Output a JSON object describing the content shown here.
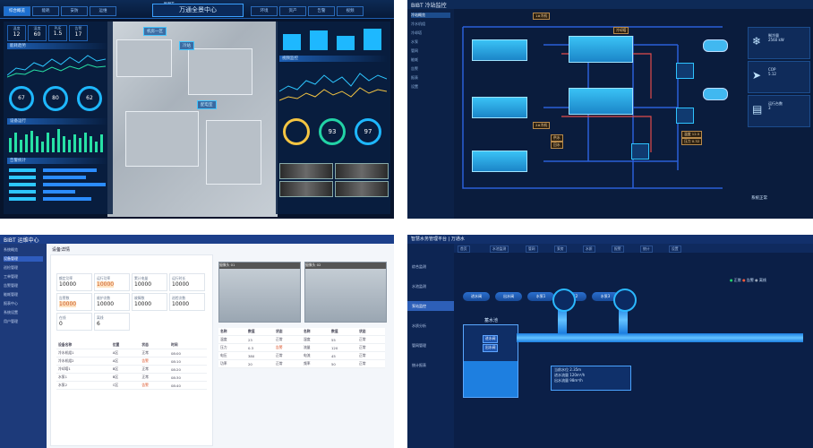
{
  "panel1": {
    "brand": "BIBT",
    "title": "万通全景中心",
    "tabs": [
      "综合概览",
      "能耗",
      "安防",
      "运维",
      "环境",
      "资产",
      "告警",
      "视频"
    ],
    "stats": [
      {
        "label": "温度",
        "value": "12"
      },
      {
        "label": "湿度",
        "value": "60"
      },
      {
        "label": "PUE",
        "value": "1.5"
      },
      {
        "label": "告警",
        "value": "17"
      }
    ],
    "rings": [
      "67",
      "80",
      "62"
    ],
    "big_rings": [
      "93",
      "97"
    ],
    "markers": [
      "机房一区",
      "冷站",
      "配电室"
    ],
    "sec_heads": [
      "能耗趋势",
      "设备运行",
      "告警统计",
      "视频监控"
    ]
  },
  "panel2": {
    "brand": "BIBT 冷站监控",
    "menu": [
      "冷站概览",
      "冷水机组",
      "冷却塔",
      "水泵",
      "管网",
      "能耗",
      "告警",
      "报表",
      "设置"
    ],
    "labels": [
      "1#冷机",
      "2#冷机",
      "冷却塔",
      "供水",
      "回水",
      "温度 12.5",
      "压力 0.32"
    ],
    "right_boxes": [
      {
        "icon": "❄",
        "lines": [
          "制冷量",
          "2560 kW"
        ]
      },
      {
        "icon": "➤",
        "lines": [
          "COP",
          "5.12"
        ]
      },
      {
        "icon": "▤",
        "lines": [
          "运行台数",
          "3"
        ]
      }
    ],
    "footer": "系统正常"
  },
  "panel3": {
    "brand": "BIBT 运维中心",
    "menu": [
      "系统概览",
      "设备管理",
      "巡检管理",
      "工单管理",
      "告警管理",
      "能耗管理",
      "报表中心",
      "系统设置",
      "用户管理"
    ],
    "page_title": "设备详情",
    "fields": [
      {
        "label": "额定功率",
        "value": "10000"
      },
      {
        "label": "运行功率",
        "value": "10000",
        "warn": true
      },
      {
        "label": "累计电量",
        "value": "10000"
      },
      {
        "label": "运行时长",
        "value": "10000"
      },
      {
        "label": "告警数",
        "value": "10000",
        "warn": true
      },
      {
        "label": "维护次数",
        "value": "10000"
      },
      {
        "label": "故障数",
        "value": "10000"
      },
      {
        "label": "巡检次数",
        "value": "10000"
      },
      {
        "label": "在线",
        "value": "0"
      },
      {
        "label": "离线",
        "value": "6"
      }
    ],
    "table_head": [
      "设备名称",
      "位置",
      "状态",
      "时间"
    ],
    "table_rows": [
      [
        "冷水机组1",
        "A区",
        "正常",
        "08:00"
      ],
      [
        "冷水机组2",
        "A区",
        "告警",
        "08:10"
      ],
      [
        "冷却塔1",
        "B区",
        "正常",
        "08:20"
      ],
      [
        "水泵1",
        "B区",
        "正常",
        "08:30"
      ],
      [
        "水泵2",
        "C区",
        "告警",
        "08:40"
      ]
    ],
    "cams": [
      "摄像头 01",
      "摄像头 02"
    ],
    "right_head": [
      "名称",
      "数值",
      "状态",
      "名称",
      "数值",
      "状态"
    ],
    "right_rows": [
      [
        "温度",
        "23",
        "正常",
        "湿度",
        "55",
        "正常"
      ],
      [
        "压力",
        "0.3",
        "告警",
        "流量",
        "120",
        "正常"
      ],
      [
        "电压",
        "380",
        "正常",
        "电流",
        "45",
        "正常"
      ],
      [
        "功率",
        "20",
        "正常",
        "频率",
        "50",
        "正常"
      ]
    ]
  },
  "panel4": {
    "brand": "智慧水务管理平台 | 万通水",
    "tabs": [
      "首页",
      "水池监测",
      "管网",
      "泵房",
      "水质",
      "报警",
      "统计",
      "设置"
    ],
    "menu": [
      "综合监测",
      "水池监测",
      "泵站监控",
      "水质分析",
      "管网管理",
      "统计报表"
    ],
    "buttons": [
      "进水阀",
      "出水阀",
      "水泵1",
      "水泵2",
      "水泵3"
    ],
    "tank_label": "蓄水池",
    "info_lines": [
      "当前水位 2.35m",
      "进水流量 120m³/h",
      "出水流量 98m³/h"
    ],
    "legend": [
      "正常",
      "告警",
      "离线"
    ],
    "colors": {
      "normal": "#22d36a",
      "alarm": "#ff5a3a",
      "offline": "#9aa7b8"
    }
  }
}
